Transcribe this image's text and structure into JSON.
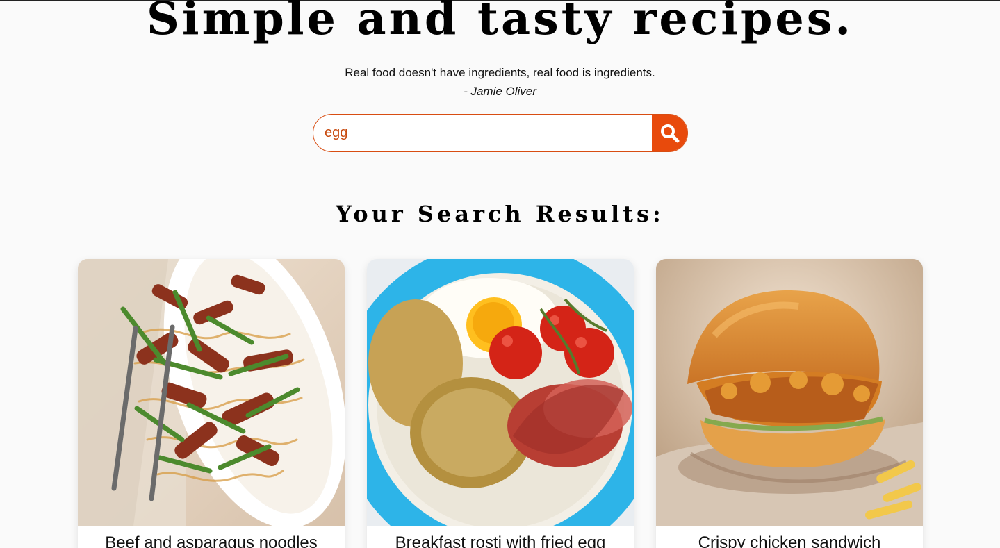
{
  "hero": {
    "title": "Simple and tasty recipes.",
    "quote": "Real food doesn't have ingredients, real food is ingredients.",
    "author": "- Jamie Oliver"
  },
  "search": {
    "value": "egg",
    "button_icon": "search-icon",
    "accent_color": "#e84a0c"
  },
  "results": {
    "title": "Your Search Results:",
    "recipes": [
      {
        "name": "Beef and asparagus noodles",
        "image_icon": "beef-asparagus-noodles-image"
      },
      {
        "name": "Breakfast rosti with fried egg",
        "image_icon": "breakfast-rosti-image"
      },
      {
        "name": "Crispy chicken sandwich",
        "image_icon": "chicken-sandwich-image"
      }
    ]
  }
}
